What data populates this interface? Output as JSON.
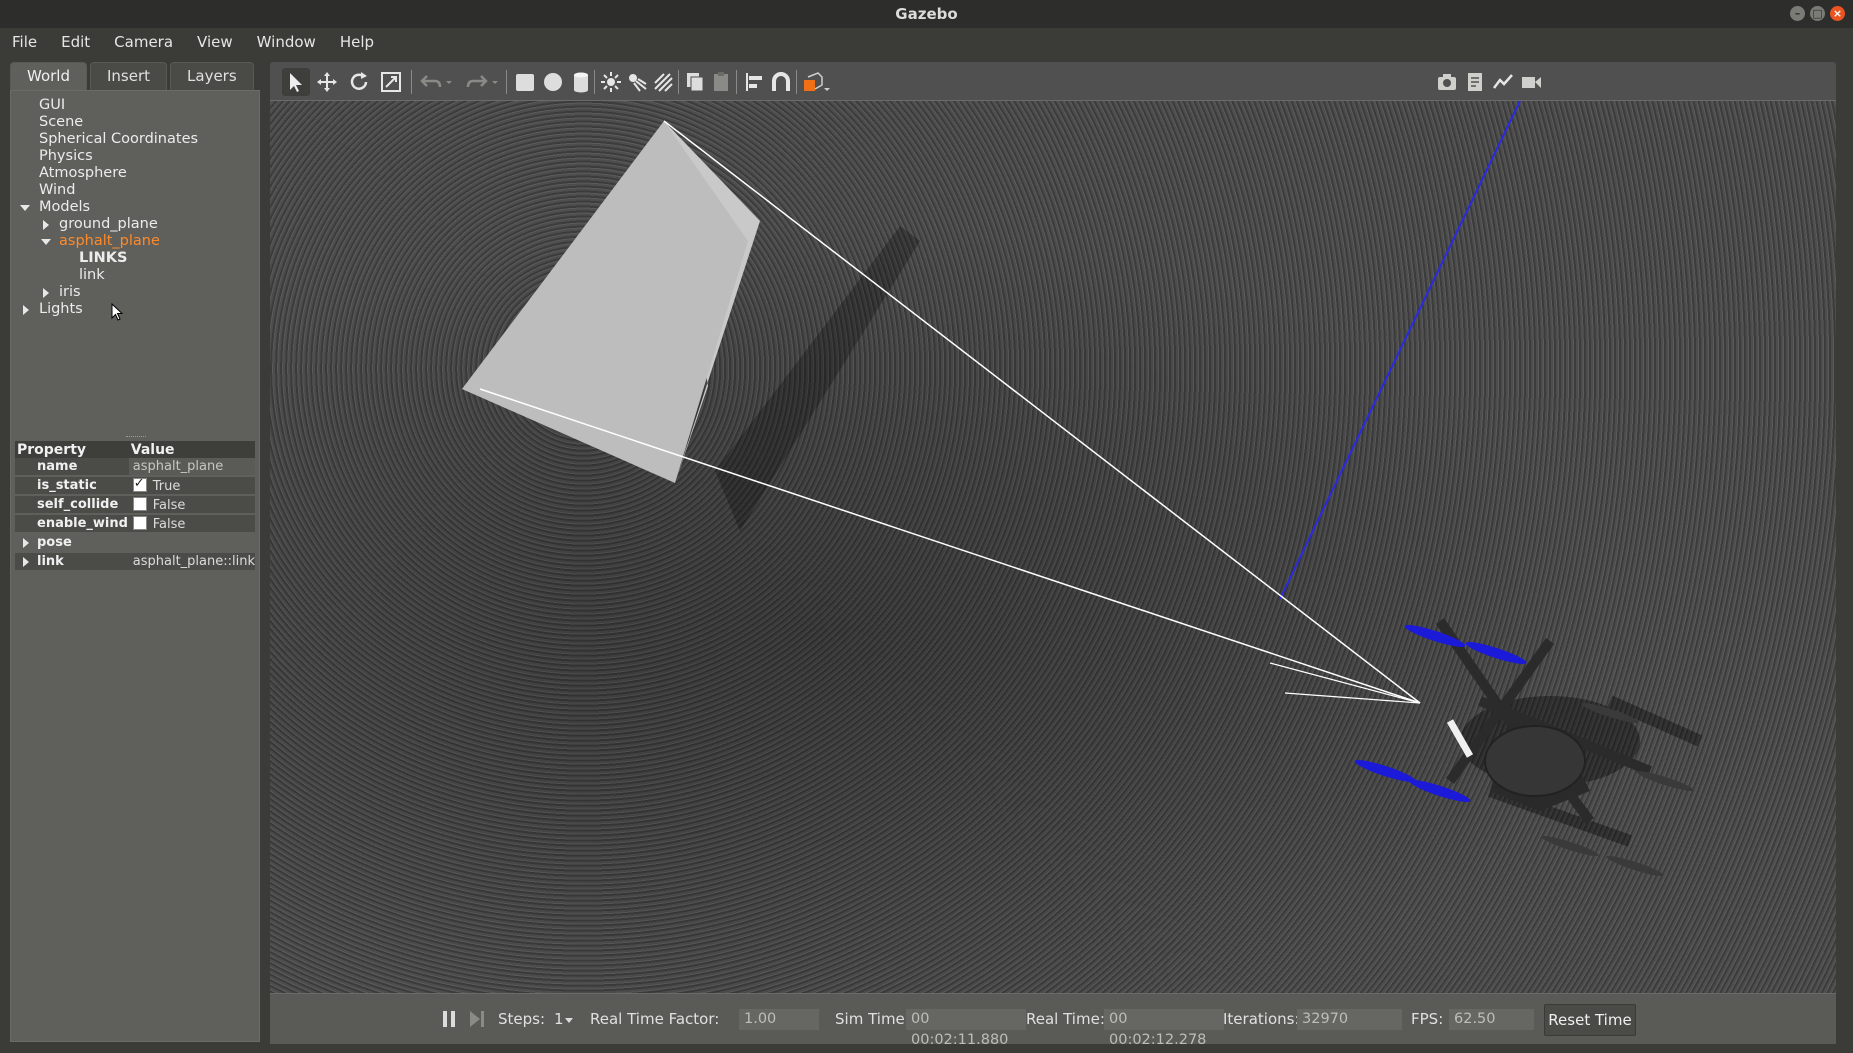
{
  "window": {
    "title": "Gazebo"
  },
  "menu": [
    {
      "label": "File"
    },
    {
      "label": "Edit"
    },
    {
      "label": "Camera"
    },
    {
      "label": "View"
    },
    {
      "label": "Window"
    },
    {
      "label": "Help"
    }
  ],
  "tabs": [
    "World",
    "Insert",
    "Layers"
  ],
  "tree": {
    "gui": "GUI",
    "scene": "Scene",
    "spherical": "Spherical Coordinates",
    "physics": "Physics",
    "atmosphere": "Atmosphere",
    "wind": "Wind",
    "models": "Models",
    "ground_plane": "ground_plane",
    "asphalt_plane": "asphalt_plane",
    "links_header": "LINKS",
    "link": "link",
    "iris": "iris",
    "lights": "Lights"
  },
  "properties": {
    "header_property": "Property",
    "header_value": "Value",
    "rows": {
      "name": {
        "key": "name",
        "value": "asphalt_plane"
      },
      "is_static": {
        "key": "is_static",
        "value": "True",
        "checked": true
      },
      "self_collide": {
        "key": "self_collide",
        "value": "False",
        "checked": false
      },
      "enable_wind": {
        "key": "enable_wind",
        "value": "False",
        "checked": false
      },
      "pose": {
        "key": "pose"
      },
      "link": {
        "key": "link",
        "value": "asphalt_plane::link"
      }
    }
  },
  "status": {
    "steps_label": "Steps:",
    "steps_value": "1",
    "rtf_label": "Real Time Factor:",
    "rtf_value": "1.00",
    "sim_label": "Sim Time:",
    "sim_value": "00 00:02:11.880",
    "real_label": "Real Time:",
    "real_value": "00 00:02:12.278",
    "iter_label": "Iterations:",
    "iter_value": "32970",
    "fps_label": "FPS:",
    "fps_value": "62.50",
    "reset_label": "Reset Time"
  },
  "colors": {
    "accent": "#e95420",
    "selected_text": "#ff8a2a",
    "propeller": "#1a1ad8",
    "axis_line": "#2a2ae0"
  }
}
